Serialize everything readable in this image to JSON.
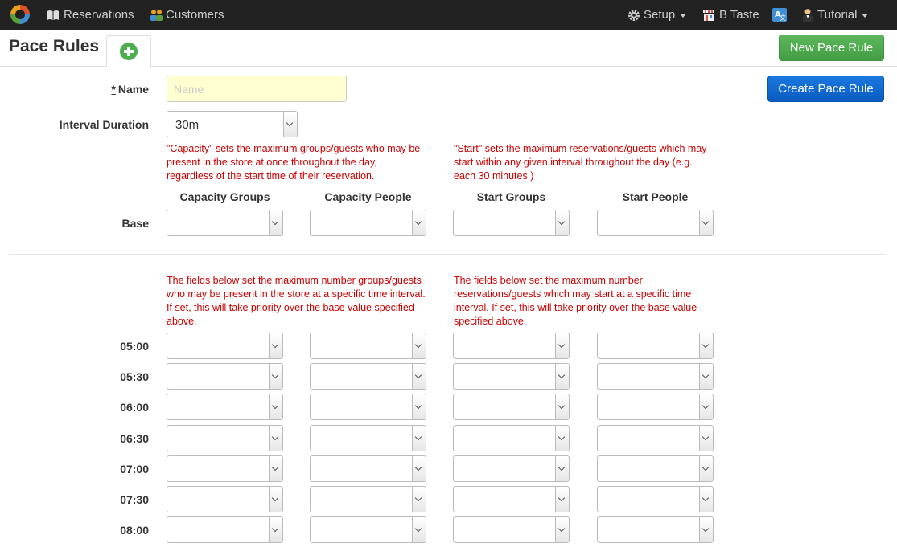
{
  "nav": {
    "reservations": "Reservations",
    "customers": "Customers",
    "setup": "Setup",
    "store": "B Taste",
    "user": "Tutorial"
  },
  "header": {
    "title": "Pace Rules",
    "new_button": "New Pace Rule",
    "create_button": "Create Pace Rule"
  },
  "form": {
    "name_required_marker": "*",
    "name_label": "Name",
    "name_placeholder": "Name",
    "name_value": "",
    "interval_label": "Interval Duration",
    "interval_value": "30m",
    "capacity_note": "\"Capacity\" sets the maximum groups/guests who may be present in the store at once throughout the day, regardless of the start time of their reservation.",
    "start_note": "\"Start\" sets the maximum reservations/guests which may start within any given interval throughout the day (e.g. each 30 minutes.)",
    "columns": [
      "Capacity Groups",
      "Capacity People",
      "Start Groups",
      "Start People"
    ],
    "base_label": "Base",
    "capacity_interval_note": "The fields below set the maximum number groups/guests who may be present in the store at a specific time interval. If set, this will take priority over the base value specified above.",
    "start_interval_note": "The fields below set the maximum number reservations/guests which may start at a specific time interval. If set, this will take priority over the base value specified above.",
    "times": [
      "05:00",
      "05:30",
      "06:00",
      "06:30",
      "07:00",
      "07:30",
      "08:00"
    ]
  },
  "colors": {
    "navbar": "#222222",
    "green_button": "#5cb85c",
    "blue_button": "#0d6fd8",
    "note_text": "#cc0000",
    "name_input_bg": "#ffffd2"
  },
  "icons": [
    "app-logo-icon",
    "book-icon",
    "users-icon",
    "gear-icon",
    "store-icon",
    "translate-icon",
    "user-icon",
    "plus-circle-icon",
    "chevron-down-icon"
  ]
}
